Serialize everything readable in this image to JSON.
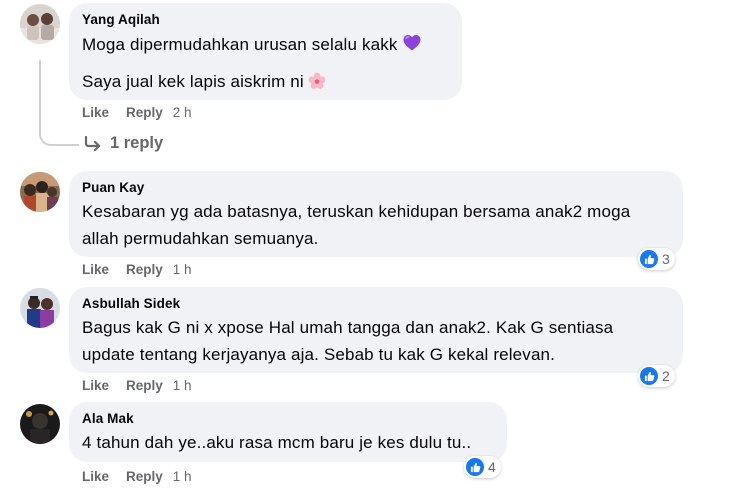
{
  "comments": [
    {
      "author": "Yang Aqilah",
      "lines": [
        "Moga dipermudahkan urusan selalu kakk",
        "Saya jual kek lapis aiskrim ni"
      ],
      "emojis": [
        "purple-heart-icon",
        "cherry-blossom-icon"
      ],
      "actions": {
        "like": "Like",
        "reply": "Reply",
        "time": "2 h"
      },
      "reply_link": "1 reply"
    },
    {
      "author": "Puan Kay",
      "lines": [
        "Kesabaran yg ada batasnya, teruskan kehidupan bersama anak2 moga",
        "allah permudahkan semuanya."
      ],
      "actions": {
        "like": "Like",
        "reply": "Reply",
        "time": "1 h"
      },
      "reaction": {
        "icon": "like-icon",
        "count": "3"
      }
    },
    {
      "author": "Asbullah Sidek",
      "lines": [
        "Bagus kak G ni x xpose Hal umah tangga dan anak2. Kak G sentiasa",
        "update tentang kerjayanya aja. Sebab tu kak G kekal relevan."
      ],
      "actions": {
        "like": "Like",
        "reply": "Reply",
        "time": "1 h"
      },
      "reaction": {
        "icon": "like-icon",
        "count": "2"
      }
    },
    {
      "author": "Ala Mak",
      "lines": [
        "4 tahun dah ye..aku rasa mcm baru je kes dulu tu.."
      ],
      "actions": {
        "like": "Like",
        "reply": "Reply",
        "time": "1 h"
      },
      "reaction": {
        "icon": "like-icon",
        "count": "4"
      }
    }
  ],
  "colors": {
    "bubble": "#f0f2f5",
    "meta": "#65676b",
    "like_blue": "#1877f2",
    "thread": "#ced0d4"
  }
}
